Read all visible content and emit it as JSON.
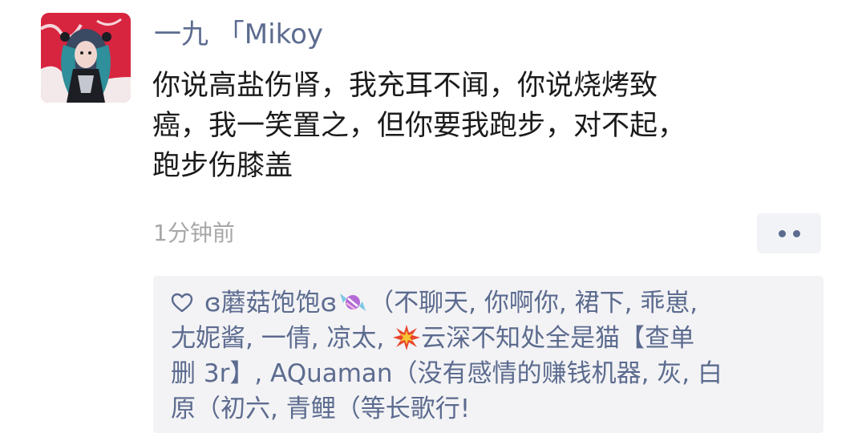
{
  "post": {
    "avatar_icon": "avatar-anime-figure",
    "username": "一九 「Mikoy",
    "text_lines": [
      "你说高盐伤肾，我充耳不闻，你说烧烤致",
      "癌，我一笑置之，但你要我跑步，对不起，",
      "跑步伤膝盖"
    ],
    "timestamp": "1分钟前",
    "more_icon": "more-dots-icon"
  },
  "likes": {
    "heart_icon": "heart-outline-icon",
    "line1_a": "ɞ蘑菇饱饱ɞ",
    "line1_emoji": "candy-icon",
    "line1_b": "（不聊天, 你啊你, 裙下, 乖崽,",
    "line2_a": "尢妮酱, 一倩, 凉太,",
    "line2_emoji": "collision-icon",
    "line2_b": "云深不知处全是猫【查单",
    "line3": "删 3r】, AQuaman（没有感情的赚钱机器, 灰, 白",
    "line4": "原（初六, 青鲤（等长歌行!"
  },
  "colors": {
    "link_blue": "#5c6b8f",
    "text": "#1b1b1b",
    "muted": "#a7a7a7",
    "box_bg": "#f3f3f5"
  }
}
